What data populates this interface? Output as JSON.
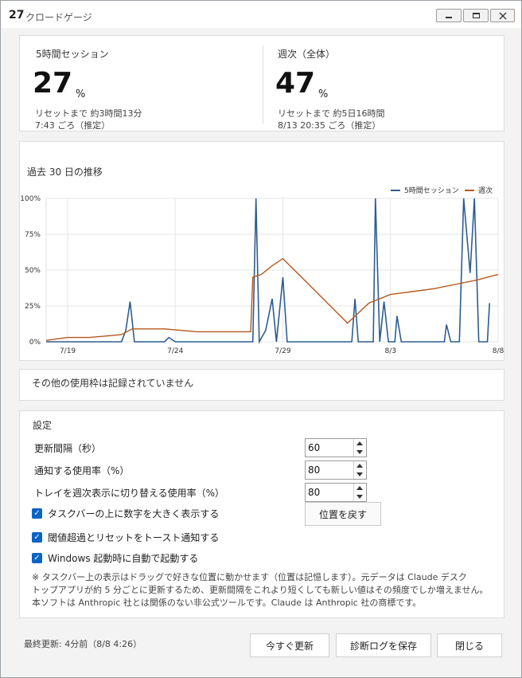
{
  "window": {
    "title_number": "27",
    "title": "クロードゲージ"
  },
  "stats": {
    "session": {
      "label": "5時間セッション",
      "value": "27",
      "unit": "%",
      "reset": "リセットまで 約3時間13分",
      "reset_time": "7:43 ごろ（推定）"
    },
    "weekly": {
      "label": "週次（全体）",
      "value": "47",
      "unit": "%",
      "reset": "リセットまで 約5日16時間",
      "reset_time": "8/13  20:35 ごろ（推定）"
    }
  },
  "chart": {
    "title": "過去 30 日の推移"
  },
  "chart_data": {
    "type": "line",
    "title": "過去 30 日の推移",
    "x_range": [
      "7/18",
      "8/8"
    ],
    "x_ticks": [
      "7/19",
      "7/24",
      "7/29",
      "8/3",
      "8/8"
    ],
    "y_ticks": [
      "0%",
      "25%",
      "50%",
      "75%",
      "100%"
    ],
    "ylim": [
      0,
      100
    ],
    "grid": true,
    "legend_position": "top-right",
    "series": [
      {
        "name": "5時間セッション",
        "color": "#2e5d91",
        "points": [
          [
            "7/18",
            0
          ],
          [
            "7/21.5",
            0
          ],
          [
            "7/21.7",
            8
          ],
          [
            "7/21.9",
            28
          ],
          [
            "7/22.1",
            0
          ],
          [
            "7/23.5",
            0
          ],
          [
            "7/23.7",
            3
          ],
          [
            "7/24.0",
            0
          ],
          [
            "7/27.6",
            0
          ],
          [
            "7/27.75",
            100
          ],
          [
            "7/27.9",
            0
          ],
          [
            "7/28.2",
            8
          ],
          [
            "7/28.5",
            30
          ],
          [
            "7/28.7",
            0
          ],
          [
            "7/29.0",
            45
          ],
          [
            "7/29.2",
            0
          ],
          [
            "8/1.2",
            0
          ],
          [
            "8/1.35",
            30
          ],
          [
            "8/1.5",
            0
          ],
          [
            "8/2.2",
            0
          ],
          [
            "8/2.3",
            100
          ],
          [
            "8/2.5",
            0
          ],
          [
            "8/2.7",
            28
          ],
          [
            "8/2.9",
            0
          ],
          [
            "8/3.2",
            0
          ],
          [
            "8/3.3",
            18
          ],
          [
            "8/3.5",
            0
          ],
          [
            "8/5.5",
            0
          ],
          [
            "8/5.6",
            12
          ],
          [
            "8/5.8",
            0
          ],
          [
            "8/6.2",
            0
          ],
          [
            "8/6.4",
            100
          ],
          [
            "8/6.7",
            48
          ],
          [
            "8/6.9",
            100
          ],
          [
            "8/7.1",
            0
          ],
          [
            "8/7.5",
            0
          ],
          [
            "8/7.6",
            27
          ]
        ]
      },
      {
        "name": "週次",
        "color": "#b5581d",
        "points": [
          [
            "7/18",
            1
          ],
          [
            "7/19",
            3
          ],
          [
            "7/20",
            3
          ],
          [
            "7/21.5",
            5
          ],
          [
            "7/22",
            9
          ],
          [
            "7/23.5",
            9
          ],
          [
            "7/25",
            7
          ],
          [
            "7/27.5",
            7
          ],
          [
            "7/27.6",
            45
          ],
          [
            "7/28",
            47
          ],
          [
            "7/28.5",
            53
          ],
          [
            "7/29",
            58
          ],
          [
            "8/1",
            13
          ],
          [
            "8/2",
            27
          ],
          [
            "8/3",
            33
          ],
          [
            "8/4",
            35
          ],
          [
            "8/5",
            37
          ],
          [
            "8/6",
            40
          ],
          [
            "8/7",
            43
          ],
          [
            "8/8",
            47
          ]
        ]
      }
    ]
  },
  "other": {
    "text": "その他の使用枠は記録されていません"
  },
  "settings": {
    "title": "設定",
    "refresh_label": "更新間隔（秒）",
    "refresh_value": "60",
    "notify_label": "通知する使用率（%）",
    "notify_value": "80",
    "tray_label": "トレイを週次表示に切り替える使用率（%）",
    "tray_value": "80",
    "check_taskbar": "タスクバーの上に数字を大きく表示する",
    "check_toast": "閾値超過とリセットをトースト通知する",
    "check_startup": "Windows 起動時に自動で起動する",
    "reset_position": "位置を戻す",
    "note_1": "※ タスクバー上の表示はドラッグで好きな位置に動かせます（位置は記憶します）。元データは Claude デスク",
    "note_2": "トップアプリが約 5 分ごとに更新するため、更新間隔をこれより短くしても新しい値はその頻度でしか増えません。",
    "note_3": "本ソフトは Anthropic 社とは関係のない非公式ツールです。Claude は Anthropic 社の商標です。"
  },
  "footer": {
    "last_updated": "最終更新: 4分前（8/8 4:26）",
    "refresh_now": "今すぐ更新",
    "save_log": "診断ログを保存",
    "close": "閉じる"
  }
}
